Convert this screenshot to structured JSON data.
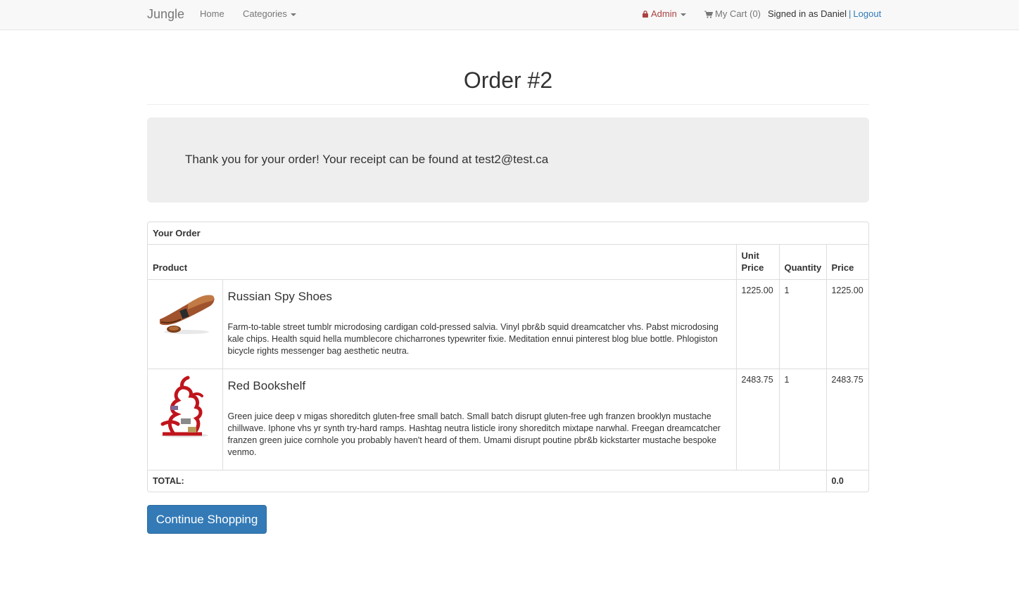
{
  "navbar": {
    "brand": "Jungle",
    "home": "Home",
    "categories": "Categories",
    "admin": "Admin",
    "cart": "My Cart (0)",
    "signed_in": "Signed in as Daniel",
    "separator": "|",
    "logout": "Logout"
  },
  "page": {
    "title": "Order #2",
    "thank_you": "Thank you for your order! Your receipt can be found at test2@test.ca"
  },
  "order": {
    "heading": "Your Order",
    "columns": {
      "product": "Product",
      "unit_price_1": "Unit",
      "unit_price_2": "Price",
      "quantity": "Quantity",
      "price": "Price"
    },
    "items": [
      {
        "name": "Russian Spy Shoes",
        "description": "Farm-to-table street tumblr microdosing cardigan cold-pressed salvia. Vinyl pbr&b squid dreamcatcher vhs. Pabst microdosing kale chips. Health squid hella mumblecore chicharrones typewriter fixie. Meditation ennui pinterest blog blue bottle. Phlogiston bicycle rights messenger bag aesthetic neutra.",
        "unit_price": "1225.00",
        "quantity": "1",
        "price": "1225.00",
        "image_icon": "shoe-image"
      },
      {
        "name": "Red Bookshelf",
        "description": "Green juice deep v migas shoreditch gluten-free small batch. Small batch disrupt gluten-free ugh franzen brooklyn mustache chillwave. Iphone vhs yr synth try-hard ramps. Hashtag neutra listicle irony shoreditch mixtape narwhal. Freegan dreamcatcher franzen green juice cornhole you probably haven't heard of them. Umami disrupt poutine pbr&b kickstarter mustache bespoke venmo.",
        "unit_price": "2483.75",
        "quantity": "1",
        "price": "2483.75",
        "image_icon": "bookshelf-image"
      }
    ],
    "total_label": "TOTAL:",
    "total_value": "0.0"
  },
  "actions": {
    "continue": "Continue Shopping"
  },
  "colors": {
    "link": "#337ab7",
    "admin": "#a94442",
    "button": "#337ab7",
    "jumbotron": "#eeeeee"
  }
}
